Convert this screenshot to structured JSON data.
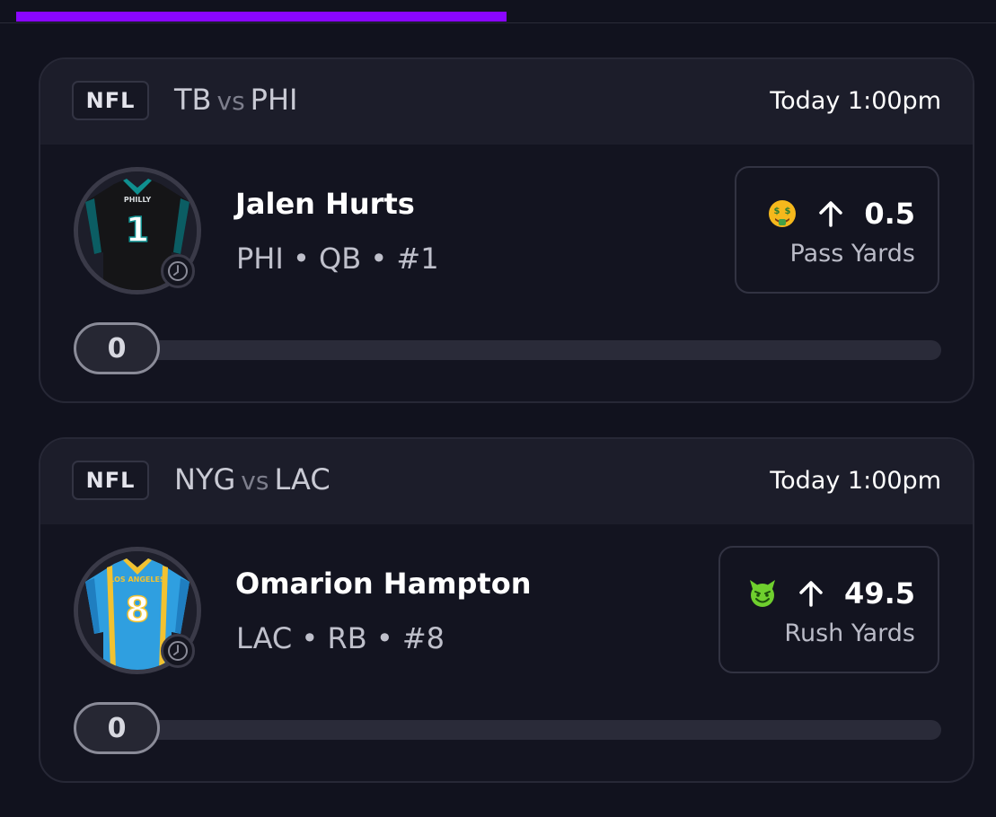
{
  "top_progress": {
    "value": 0.5
  },
  "colors": {
    "accent": "#8a06ff",
    "background": "#11121e",
    "card_header": "#1c1d2a",
    "card_border": "#272836"
  },
  "cards": [
    {
      "league": "NFL",
      "away_team": "TB",
      "vs": "vs",
      "home_team": "PHI",
      "time": "Today 1:00pm",
      "player": {
        "name": "Jalen Hurts",
        "meta": "PHI • QB • #1",
        "avatar_icon": "jersey-icon",
        "jersey_text": "PHILLY",
        "jersey_number": "1"
      },
      "pick": {
        "emoji_icon": "money-mouth-face-icon",
        "direction_icon": "arrow-up-icon",
        "line": "0.5",
        "stat": "Pass Yards"
      },
      "progress": {
        "value": 0,
        "label": "0"
      }
    },
    {
      "league": "NFL",
      "away_team": "NYG",
      "vs": "vs",
      "home_team": "LAC",
      "time": "Today 1:00pm",
      "player": {
        "name": "Omarion Hampton",
        "meta": "LAC • RB • #8",
        "avatar_icon": "jersey-icon",
        "jersey_text": "LOS ANGELES",
        "jersey_number": "8"
      },
      "pick": {
        "emoji_icon": "smiling-devil-face-icon",
        "direction_icon": "arrow-up-icon",
        "line": "49.5",
        "stat": "Rush Yards"
      },
      "progress": {
        "value": 0,
        "label": "0"
      }
    }
  ]
}
